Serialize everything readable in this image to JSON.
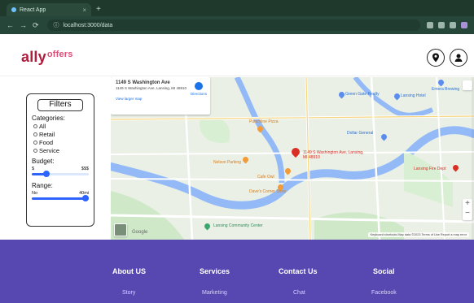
{
  "browser": {
    "tab_title": "React App",
    "new_tab_label": "+",
    "url": "localhost:3000/data"
  },
  "header": {
    "logo_main": "ally",
    "logo_sup": "offers",
    "icons": [
      "location-pin-icon",
      "user-icon"
    ]
  },
  "filters": {
    "title": "Filters",
    "categories_label": "Categories:",
    "categories": [
      "All",
      "Retail",
      "Food",
      "Service"
    ],
    "budget_label": "Budget:",
    "budget_min": "$",
    "budget_max": "$$$",
    "budget_value": 0.25,
    "range_label": "Range:",
    "range_min": "No",
    "range_max": "40mi",
    "range_value": 1.0
  },
  "map": {
    "info_title": "1149 S Washington Ave",
    "info_address": "1149 S Washington Ave, Lansing, MI 48910",
    "info_link": "View larger map",
    "directions_label": "Directions",
    "marker_label": "1149 S Washington Ave, Lansing, MI 48910",
    "places": [
      {
        "name": "Punchline Pizza",
        "color": "orange"
      },
      {
        "name": "Green Gate Realty",
        "color": "blue"
      },
      {
        "name": "Lansing Hotel",
        "color": "blue"
      },
      {
        "name": "Emera Brewing",
        "color": "blue"
      },
      {
        "name": "Cafe Owl",
        "color": "orange"
      },
      {
        "name": "Nelson Parking",
        "color": "orange"
      },
      {
        "name": "Dave's Corner Store",
        "color": "orange"
      },
      {
        "name": "Dollar General",
        "color": "blue"
      },
      {
        "name": "Lansing Fire Dept",
        "color": "red"
      },
      {
        "name": "Lansing Community Center",
        "color": "green"
      }
    ],
    "footer_text": "Keyboard shortcuts  Map data ©2023  Terms of Use  Report a map error",
    "google_label": "Google"
  },
  "footer": {
    "columns": [
      {
        "title": "About US",
        "link": "Story"
      },
      {
        "title": "Services",
        "link": "Marketing"
      },
      {
        "title": "Contact Us",
        "link": "Chat"
      },
      {
        "title": "Social",
        "link": "Facebook"
      }
    ]
  },
  "colors": {
    "logo": "#b01c3c",
    "footer_bg": "#5747b0",
    "accent_blue": "#2d63ff",
    "map_bg": "#eaf0e6"
  }
}
